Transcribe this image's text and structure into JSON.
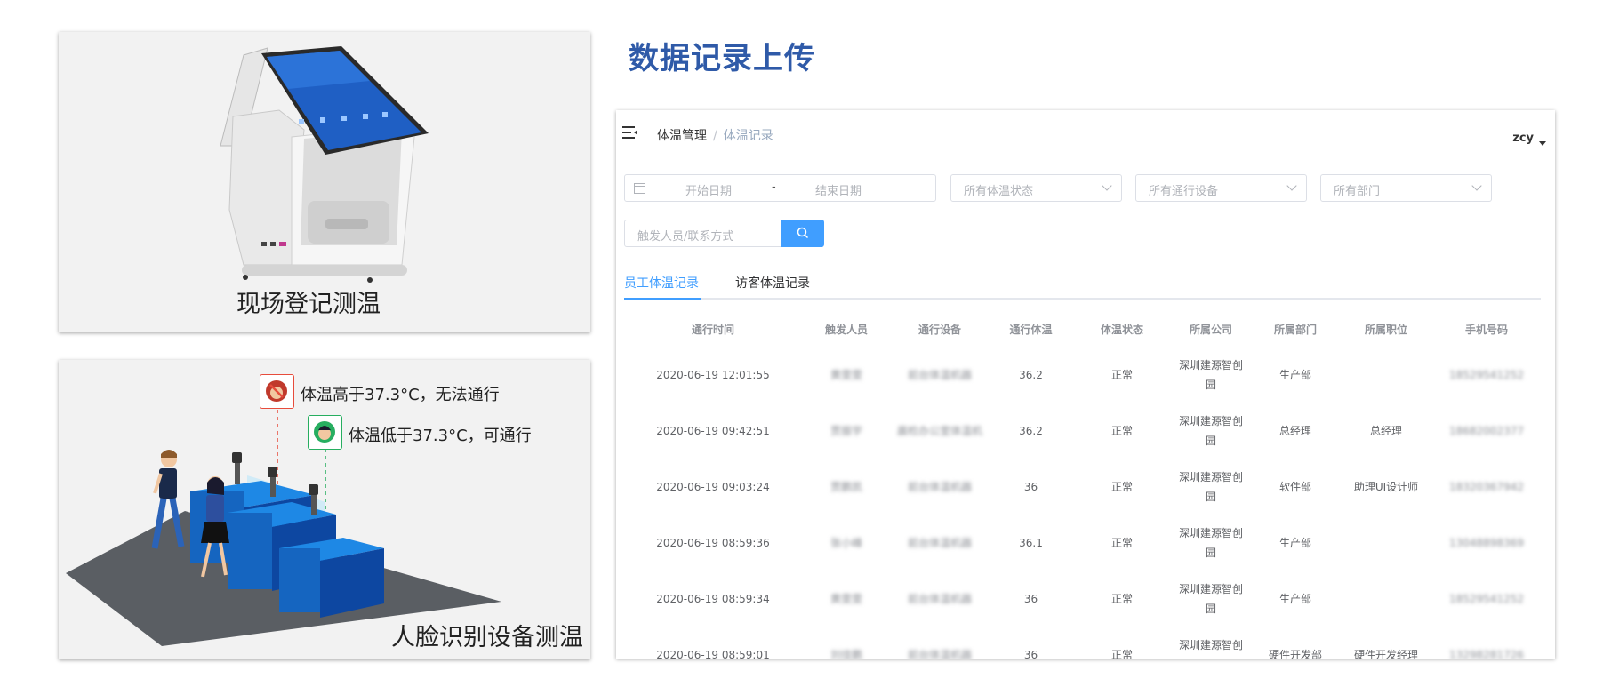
{
  "left": {
    "top_caption": "现场登记测温",
    "bottom_caption": "人脸识别设备测温",
    "alert_high": "体温高于37.3°C，无法通行",
    "alert_low": "体温低于37.3°C，可通行"
  },
  "section_title": "数据记录上传",
  "app": {
    "breadcrumb": [
      "体温管理",
      "体温记录"
    ],
    "user": "zcy",
    "filters": {
      "start_date_placeholder": "开始日期",
      "date_separator": "-",
      "end_date_placeholder": "结束日期",
      "status_placeholder": "所有体温状态",
      "device_placeholder": "所有通行设备",
      "dept_placeholder": "所有部门",
      "search_placeholder": "触发人员/联系方式"
    },
    "tabs": [
      {
        "label": "员工体温记录",
        "active": true
      },
      {
        "label": "访客体温记录",
        "active": false
      }
    ],
    "table": {
      "columns": [
        "通行时间",
        "触发人员",
        "通行设备",
        "通行体温",
        "体温状态",
        "所属公司",
        "所属部门",
        "所属职位",
        "手机号码"
      ],
      "rows": [
        [
          "2020-06-19 12:01:55",
          "黄雯雯",
          "前台体温机器",
          "36.2",
          "正常",
          "深圳建源智创园",
          "生产部",
          "",
          "18529541252"
        ],
        [
          "2020-06-19 09:42:51",
          "贾振宇",
          "晨检办公室体温机",
          "36.2",
          "正常",
          "深圳建源智创园",
          "总经理",
          "总经理",
          "18682002377"
        ],
        [
          "2020-06-19 09:03:24",
          "贾鹏凯",
          "前台体温机器",
          "36",
          "正常",
          "深圳建源智创园",
          "软件部",
          "助理UI设计师",
          "18320367942"
        ],
        [
          "2020-06-19 08:59:36",
          "张小峰",
          "前台体温机器",
          "36.1",
          "正常",
          "深圳建源智创园",
          "生产部",
          "",
          "13048898369"
        ],
        [
          "2020-06-19 08:59:34",
          "黄雯雯",
          "前台体温机器",
          "36",
          "正常",
          "深圳建源智创园",
          "生产部",
          "",
          "18529541252"
        ],
        [
          "2020-06-19 08:59:01",
          "刘佳鹏",
          "前台体温机器",
          "36",
          "正常",
          "深圳建源智创园",
          "硬件开发部",
          "硬件开发经理",
          "13298281726"
        ]
      ]
    }
  },
  "colors": {
    "title_blue": "#2f5aa8",
    "primary": "#409eff",
    "turnstile_blue": "#1565c0",
    "alert_red": "#e74c3c",
    "alert_green": "#27ae60"
  }
}
